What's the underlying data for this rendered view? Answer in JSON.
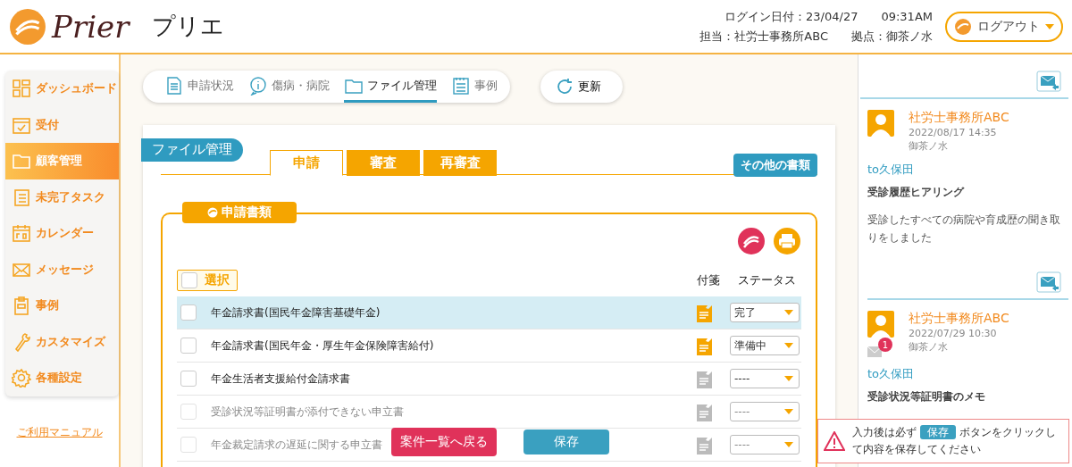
{
  "header": {
    "logo_text": "Prier",
    "app_name": "プリエ",
    "login_label": "ログイン日付：23/04/27",
    "login_time": "09:31AM",
    "staff": "担当：社労士事務所ABC",
    "base": "拠点：御茶ノ水",
    "logout": "ログアウト"
  },
  "sidebar": {
    "items": [
      {
        "label": "ダッシュボード",
        "selected": false
      },
      {
        "label": "受付",
        "selected": false
      },
      {
        "label": "顧客管理",
        "selected": true
      },
      {
        "label": "未完了タスク",
        "selected": false
      },
      {
        "label": "カレンダー",
        "selected": false
      },
      {
        "label": "メッセージ",
        "selected": false
      },
      {
        "label": "事例",
        "selected": false
      },
      {
        "label": "カスタマイズ",
        "selected": false
      },
      {
        "label": "各種設定",
        "selected": false
      }
    ],
    "manual_link": "ご利用マニュアル"
  },
  "top_tabs": [
    {
      "label": "申請状況",
      "selected": false
    },
    {
      "label": "傷病・病院",
      "selected": false
    },
    {
      "label": "ファイル管理",
      "selected": true
    },
    {
      "label": "事例",
      "selected": false
    }
  ],
  "refresh_button": "更新",
  "card": {
    "title": "ファイル管理",
    "tabs": [
      {
        "label": "申請",
        "selected": true
      },
      {
        "label": "審査",
        "selected": false
      },
      {
        "label": "再審査",
        "selected": false
      }
    ],
    "other_docs_button": "その他の書類",
    "section": {
      "title": "申請書類",
      "select_label": "選択",
      "select_checked": false,
      "columns": [
        "付箋",
        "ステータス"
      ],
      "rows": [
        {
          "name": "年金請求書(国民年金障害基礎年金)",
          "checked": false,
          "selected": true,
          "note": true,
          "status": "完了",
          "faded": false
        },
        {
          "name": "年金請求書(国民年金・厚生年金保険障害給付)",
          "checked": false,
          "selected": false,
          "note": true,
          "status": "準備中",
          "faded": false
        },
        {
          "name": "年金生活者支援給付金請求書",
          "checked": false,
          "selected": false,
          "note": false,
          "status": "----",
          "faded": false
        },
        {
          "name": "受診状況等証明書が添付できない申立書",
          "checked": false,
          "selected": false,
          "note": false,
          "status": "----",
          "faded": true
        },
        {
          "name": "年金裁定請求の遅延に関する申立書",
          "checked": false,
          "selected": false,
          "note": false,
          "status": "----",
          "faded": true
        }
      ]
    }
  },
  "messages": [
    {
      "sender": "社労士事務所ABC",
      "date": "2022/08/17 14:35",
      "place": "御茶ノ水",
      "to": "to久保田",
      "subject": "受診履歴ヒアリング",
      "body": "受診したすべての病院や育成歴の聞き取りをしました"
    },
    {
      "sender": "社労士事務所ABC",
      "date": "2022/07/29 10:30",
      "place": "御茶ノ水",
      "to": "to久保田",
      "subject": "受診状況等証明書のメモ",
      "unread": "1"
    }
  ],
  "footer": {
    "back_button": "案件一覧へ戻る",
    "save_button": "保存",
    "notice_before": "入力後は必ず",
    "notice_button": "保存",
    "notice_after": "ボタンをクリックして内容を保存してください"
  }
}
